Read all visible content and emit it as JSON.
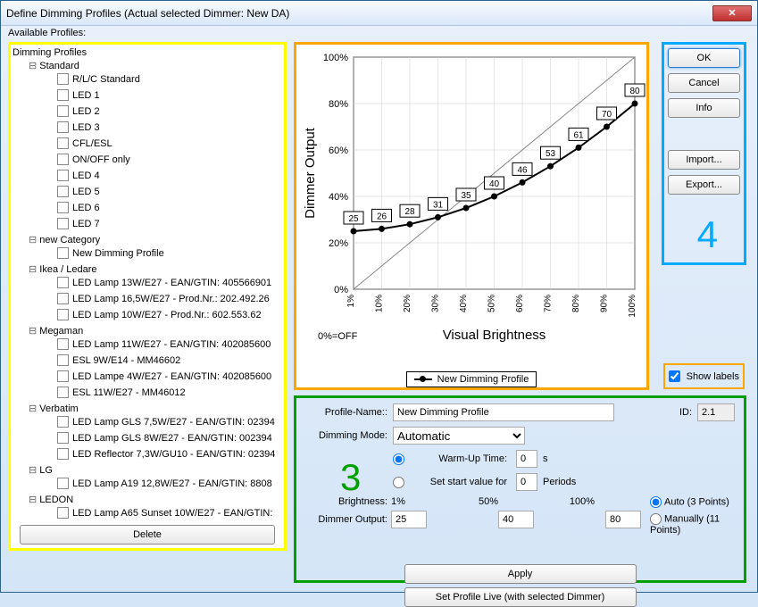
{
  "window": {
    "title": "Define Dimming Profiles (Actual selected Dimmer: New DA)"
  },
  "labels": {
    "available_profiles": "Available Profiles:",
    "delete": "Delete",
    "show_labels": "Show labels",
    "profile_name": "Profile-Name::",
    "id": "ID:",
    "dimming_mode": "Dimming Mode:",
    "warm_up_time": "Warm-Up Time:",
    "seconds": "s",
    "set_start_value": "Set start value for",
    "periods": "Periods",
    "brightness": "Brightness:",
    "dimmer_output": "Dimmer Output:",
    "auto3": "Auto (3 Points)",
    "manual11": "Manually (11 Points)",
    "apply": "Apply",
    "set_live": "Set Profile Live (with selected Dimmer)",
    "ok": "OK",
    "cancel": "Cancel",
    "info": "Info",
    "import": "Import...",
    "export": "Export..."
  },
  "tree": {
    "root": "Dimming Profiles",
    "categories": [
      {
        "name": "Standard",
        "items": [
          "R/L/C Standard",
          "LED 1",
          "LED 2",
          "LED 3",
          "CFL/ESL",
          "ON/OFF only",
          "LED 4",
          "LED 5",
          "LED 6",
          "LED 7"
        ]
      },
      {
        "name": "new Category",
        "items": [
          "New Dimming Profile"
        ]
      },
      {
        "name": "Ikea / Ledare",
        "items": [
          "LED Lamp 13W/E27 - EAN/GTIN: 405566901",
          "LED Lamp 16,5W/E27 - Prod.Nr.: 202.492.26",
          "LED Lamp 10W/E27 - Prod.Nr.: 602.553.62"
        ]
      },
      {
        "name": "Megaman",
        "items": [
          "LED Lamp 11W/E27 - EAN/GTIN: 402085600",
          "ESL 9W/E14 - MM46602",
          "LED Lampe 4W/E27 - EAN/GTIN: 402085600",
          "ESL 11W/E27 - MM46012"
        ]
      },
      {
        "name": "Verbatim",
        "items": [
          "LED Lamp GLS 7,5W/E27 - EAN/GTIN: 02394",
          "LED Lamp GLS 8W/E27 - EAN/GTIN: 002394",
          "LED Reflector 7,3W/GU10 - EAN/GTIN: 02394"
        ]
      },
      {
        "name": "LG",
        "items": [
          "LED Lamp A19 12,8W/E27 - EAN/GTIN: 8808"
        ]
      },
      {
        "name": "LEDON",
        "items": [
          "LED Lamp A65 Sunset 10W/E27 - EAN/GTIN:"
        ]
      }
    ]
  },
  "settings": {
    "profile_name": "New Dimming Profile",
    "id": "2.1",
    "dimming_mode": "Automatic",
    "warm_up_time": "0",
    "start_periods": "0",
    "brightness_pts": {
      "p1": "1%",
      "p50": "50%",
      "p100": "100%"
    },
    "dimmer_pts": {
      "p1": "25",
      "p50": "40",
      "p100": "80"
    },
    "mode_radio": "auto",
    "time_radio": "warmup"
  },
  "chart_data": {
    "type": "line",
    "title": "",
    "xlabel": "Visual Brightness",
    "ylabel": "Dimmer Output",
    "x_ticks": [
      "1%",
      "10%",
      "20%",
      "30%",
      "40%",
      "50%",
      "60%",
      "70%",
      "80%",
      "90%",
      "100%"
    ],
    "y_ticks": [
      "0%",
      "20%",
      "40%",
      "60%",
      "80%",
      "100%"
    ],
    "footnote": "0%=OFF",
    "series": [
      {
        "name": "New Dimming Profile",
        "values": [
          25,
          26,
          28,
          31,
          35,
          40,
          46,
          53,
          61,
          70,
          80
        ]
      }
    ],
    "xlim": [
      1,
      100
    ],
    "ylim": [
      0,
      100
    ],
    "show_labels": true,
    "reference_line": true
  }
}
